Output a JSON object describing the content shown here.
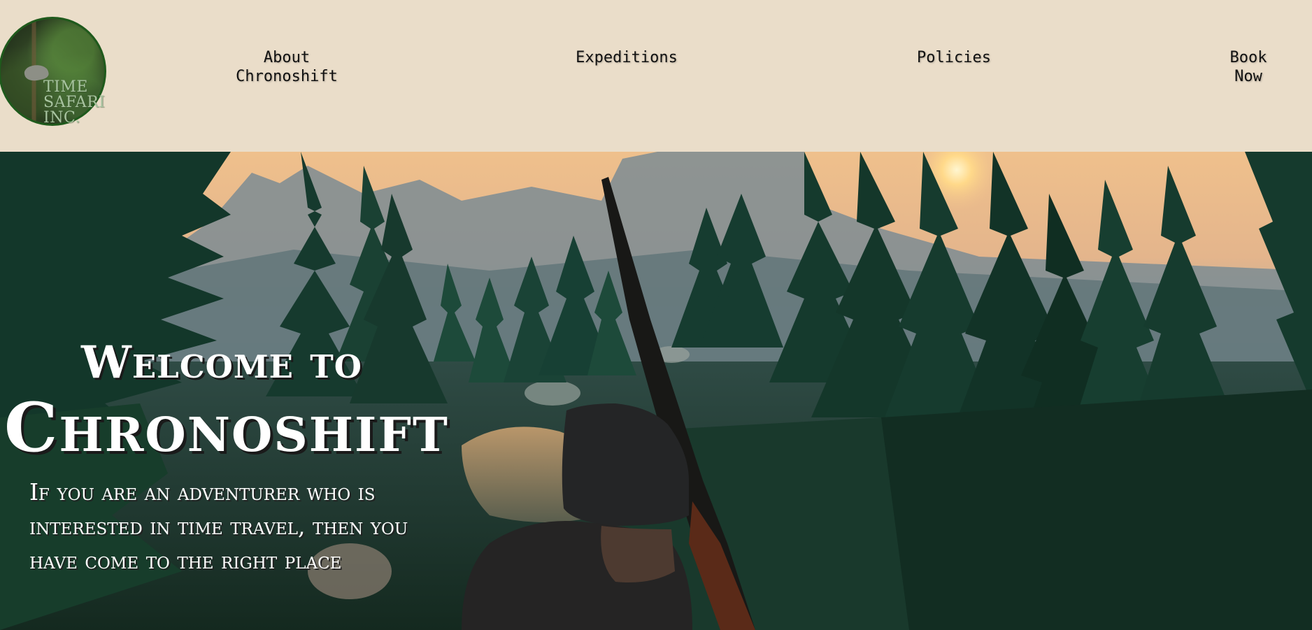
{
  "logo": {
    "text": "TIME\nSAFARI\nINC."
  },
  "nav": {
    "about": "About\nChronoshift",
    "expeditions": "Expeditions",
    "policies": "Policies",
    "book": "Book\nNow"
  },
  "hero": {
    "title_line1": "Welcome to",
    "title_line2": "Chronoshift",
    "subtitle": "If you are an adventurer who is interested in time travel, then you have come to the right place"
  },
  "colors": {
    "header_bg": "#eaddc9",
    "logo_border": "#1f5a1c",
    "hero_text": "#ffffff"
  }
}
